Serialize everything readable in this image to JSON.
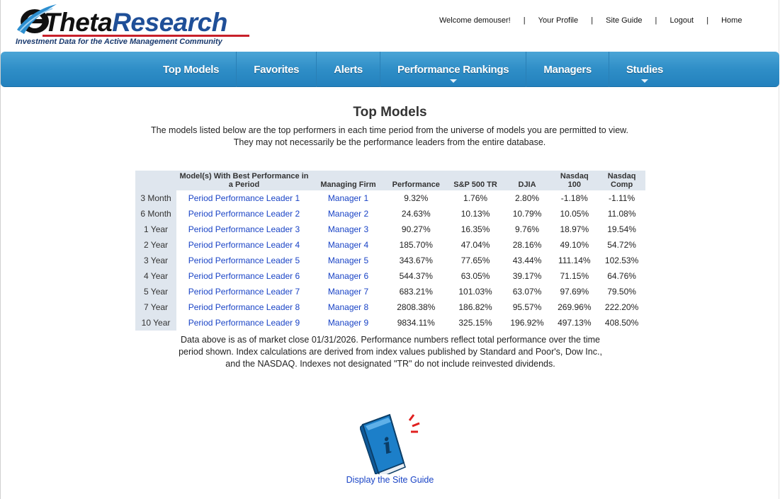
{
  "brand": {
    "name_part1": "Theta",
    "name_part2": "Research",
    "tagline": "Investment Data for the Active Management Community"
  },
  "top_nav": {
    "welcome": "Welcome demouser!",
    "links": [
      "Your Profile",
      "Site Guide",
      "Logout",
      "Home"
    ],
    "separator": "|"
  },
  "main_nav": [
    {
      "label": "Top Models",
      "dropdown": false
    },
    {
      "label": "Favorites",
      "dropdown": false
    },
    {
      "label": "Alerts",
      "dropdown": false
    },
    {
      "label": "Performance Rankings",
      "dropdown": true
    },
    {
      "label": "Managers",
      "dropdown": false
    },
    {
      "label": "Studies",
      "dropdown": true
    }
  ],
  "page": {
    "title": "Top Models",
    "intro_line1": "The models listed below are the top performers in each time period from the universe of models you are permitted to view.",
    "intro_line2": "They may not necessarily be the performance leaders from the entire database."
  },
  "table": {
    "headers": {
      "model": "Model(s) With Best Performance in a Period",
      "firm": "Managing Firm",
      "performance": "Performance",
      "sp500": "S&P 500 TR",
      "djia": "DJIA",
      "nasdaq100": "Nasdaq 100",
      "nasdaqcomp": "Nasdaq Comp"
    },
    "rows": [
      {
        "period": "3 Month",
        "model": "Period Performance Leader 1",
        "firm": "Manager 1",
        "performance": "9.32%",
        "sp500": "1.76%",
        "djia": "2.80%",
        "nasdaq100": "-1.18%",
        "nasdaqcomp": "-1.11%"
      },
      {
        "period": "6 Month",
        "model": "Period Performance Leader 2",
        "firm": "Manager 2",
        "performance": "24.63%",
        "sp500": "10.13%",
        "djia": "10.79%",
        "nasdaq100": "10.05%",
        "nasdaqcomp": "11.08%"
      },
      {
        "period": "1 Year",
        "model": "Period Performance Leader 3",
        "firm": "Manager 3",
        "performance": "90.27%",
        "sp500": "16.35%",
        "djia": "9.76%",
        "nasdaq100": "18.97%",
        "nasdaqcomp": "19.54%"
      },
      {
        "period": "2 Year",
        "model": "Period Performance Leader 4",
        "firm": "Manager 4",
        "performance": "185.70%",
        "sp500": "47.04%",
        "djia": "28.16%",
        "nasdaq100": "49.10%",
        "nasdaqcomp": "54.72%"
      },
      {
        "period": "3 Year",
        "model": "Period Performance Leader 5",
        "firm": "Manager 5",
        "performance": "343.67%",
        "sp500": "77.65%",
        "djia": "43.44%",
        "nasdaq100": "111.14%",
        "nasdaqcomp": "102.53%"
      },
      {
        "period": "4 Year",
        "model": "Period Performance Leader 6",
        "firm": "Manager 6",
        "performance": "544.37%",
        "sp500": "63.05%",
        "djia": "39.17%",
        "nasdaq100": "71.15%",
        "nasdaqcomp": "64.76%"
      },
      {
        "period": "5 Year",
        "model": "Period Performance Leader 7",
        "firm": "Manager 7",
        "performance": "683.21%",
        "sp500": "101.03%",
        "djia": "63.07%",
        "nasdaq100": "97.69%",
        "nasdaqcomp": "79.50%"
      },
      {
        "period": "7 Year",
        "model": "Period Performance Leader 8",
        "firm": "Manager 8",
        "performance": "2808.38%",
        "sp500": "186.82%",
        "djia": "95.57%",
        "nasdaq100": "269.96%",
        "nasdaqcomp": "222.20%"
      },
      {
        "period": "10 Year",
        "model": "Period Performance Leader 9",
        "firm": "Manager 9",
        "performance": "9834.11%",
        "sp500": "325.15%",
        "djia": "196.92%",
        "nasdaq100": "497.13%",
        "nasdaqcomp": "408.50%"
      }
    ]
  },
  "note": {
    "line1": "Data above is as of market close 01/31/2026. Performance numbers reflect total performance over the time",
    "line2": "period shown. Index calculations are derived from index values published by Standard and Poor's, Dow Inc.,",
    "line3": "and the NASDAQ. Indexes not designated \"TR\" do not include reinvested dividends."
  },
  "site_guide": {
    "icon": "info-book-icon",
    "link_label": "Display the Site Guide"
  },
  "colors": {
    "nav_blue": "#2f8ec7",
    "link_blue": "#1a44c6",
    "header_bg": "#dfe6ee",
    "brand_red": "#c8202a"
  }
}
